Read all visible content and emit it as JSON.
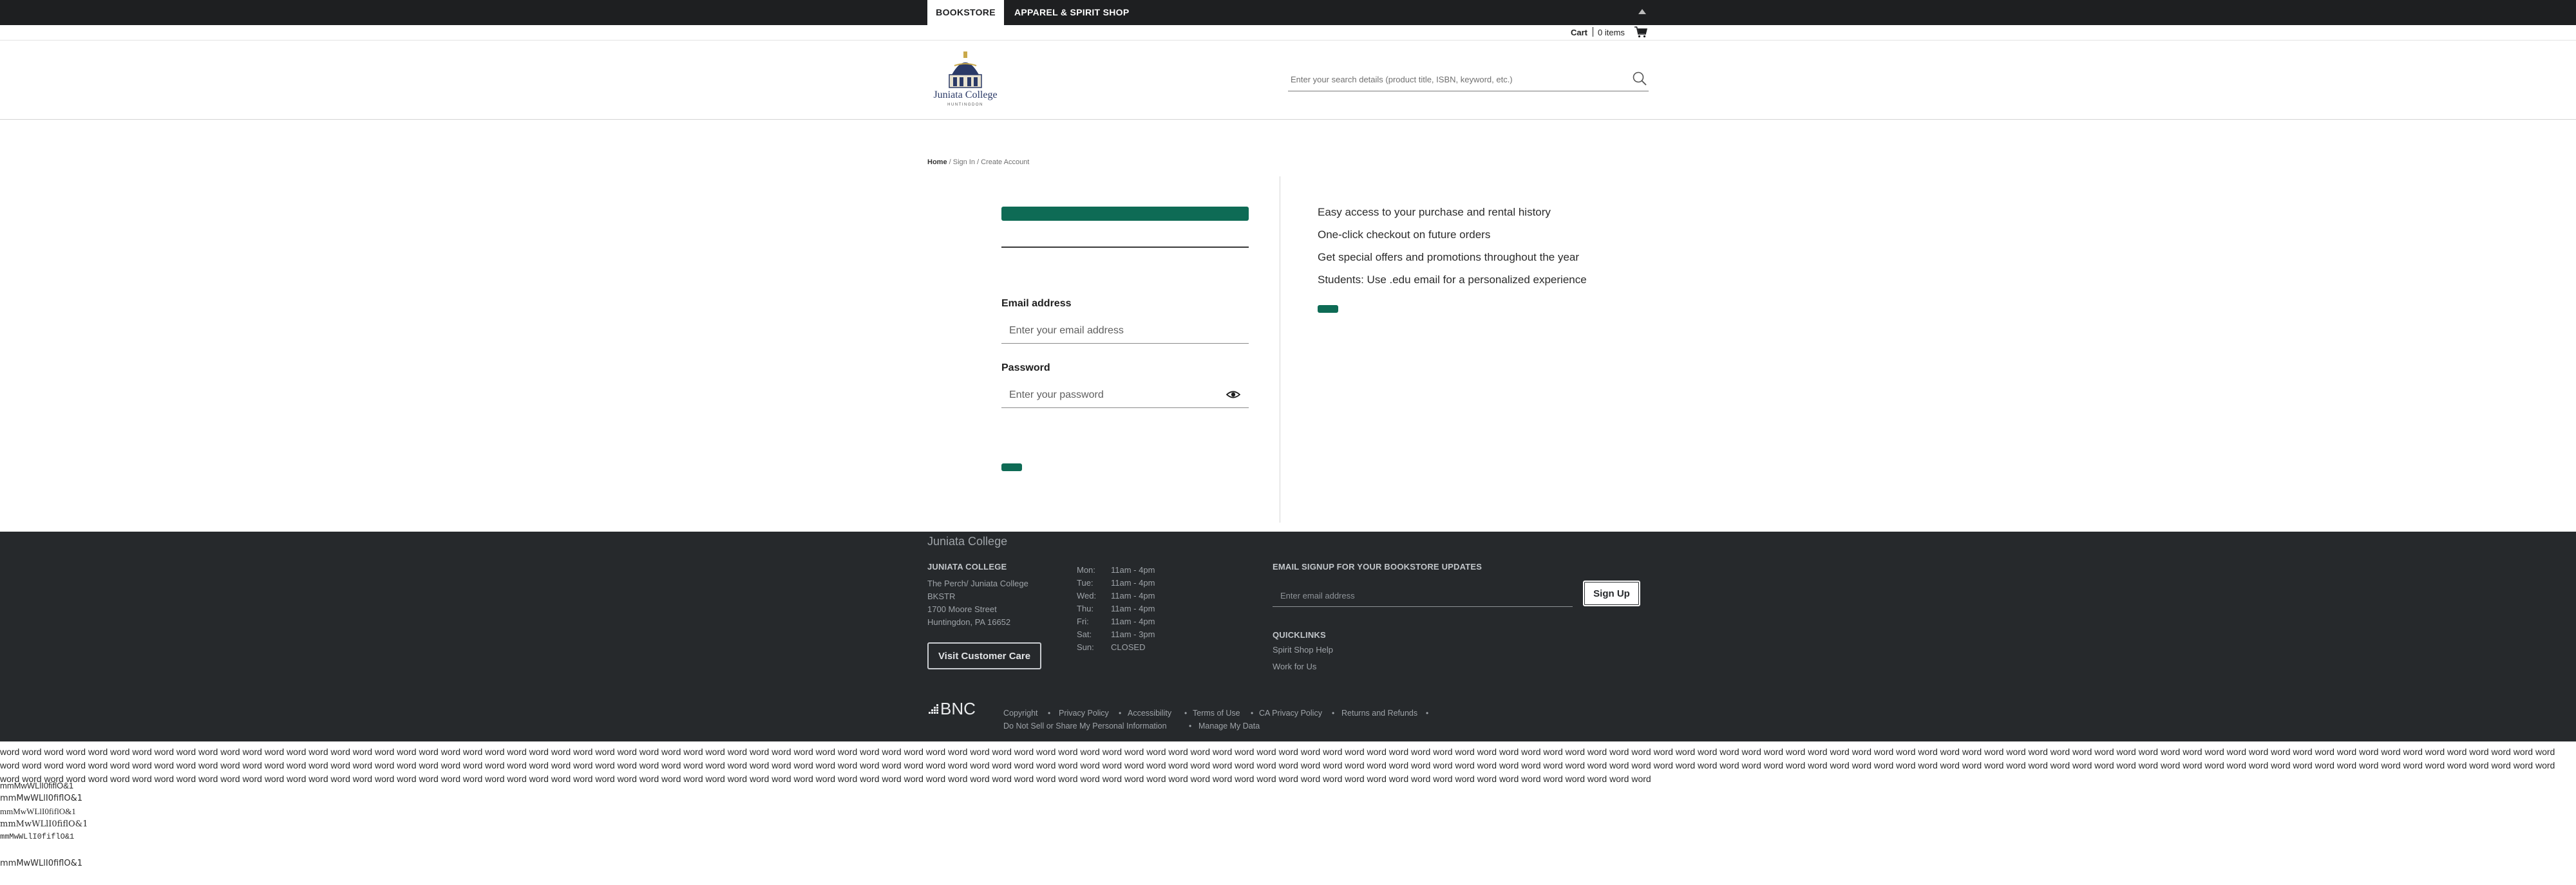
{
  "topbar": {
    "tab_bookstore": "BOOKSTORE",
    "tab_apparel": "APPAREL & SPIRIT SHOP"
  },
  "cart": {
    "label": "Cart",
    "items": "0 items"
  },
  "header": {
    "logo_name": "Juniata College",
    "logo_sub": "HUNTINGDON",
    "search_placeholder": "Enter your search details (product title, ISBN, keyword, etc.)"
  },
  "breadcrumb": {
    "home": "Home",
    "rest": " / Sign In / Create Account"
  },
  "signin": {
    "email_label": "Email address",
    "email_placeholder": "Enter your email address",
    "password_label": "Password",
    "password_placeholder": "Enter your password"
  },
  "benefits": [
    "Easy access to your purchase and rental history",
    "One-click checkout on future orders",
    "Get special offers and promotions throughout the year",
    "Students: Use .edu email for a personalized experience"
  ],
  "footer": {
    "store_name": "Juniata College",
    "address_heading": "JUNIATA COLLEGE",
    "address": [
      "The Perch/ Juniata College",
      "BKSTR",
      "1700 Moore Street",
      "Huntingdon, PA 16652"
    ],
    "visit_button": "Visit Customer Care",
    "hours": [
      {
        "day": "Mon:",
        "time": "11am - 4pm"
      },
      {
        "day": "Tue:",
        "time": "11am - 4pm"
      },
      {
        "day": "Wed:",
        "time": "11am - 4pm"
      },
      {
        "day": "Thu:",
        "time": "11am - 4pm"
      },
      {
        "day": "Fri:",
        "time": "11am - 4pm"
      },
      {
        "day": "Sat:",
        "time": "11am - 3pm"
      },
      {
        "day": "Sun:",
        "time": "CLOSED"
      }
    ],
    "signup_heading": "EMAIL SIGNUP FOR YOUR BOOKSTORE UPDATES",
    "signup_placeholder": "Enter email address",
    "signup_button": "Sign Up",
    "quicklinks_heading": "QUICKLINKS",
    "quicklinks": [
      "Spirit Shop Help",
      "Work for Us"
    ],
    "bnc_logo": "BNC",
    "legal_links": [
      "Copyright",
      "Privacy Policy",
      "Accessibility",
      "Terms of Use",
      "CA Privacy Policy",
      "Returns and Refunds",
      "Do Not Sell or Share My Personal Information",
      "Manage My Data"
    ]
  },
  "test_text": {
    "words": "word word word word word word word word word word word word word word word word word word word word word word word word word word word word word word word word word word word word word word word word word word word word word word word word word word word word word word word word word word word word word word word word word word word word word word word word word word word word word word word word word word word word word word word word word word word word word word word word word word word word word word word word word word word word word word word word word word word word word word word word word word word word word word word word word word word word word word word word word word word word word word word word word word word word word word word word word word word word word word word word word word word word word word word word word word word word word word word word word word word word word word word word word word word word word word word word word word word word word word word word word word word word word word word word word word word word word word word word word word word word word word word word word word word word word word word word word word word word word word word word word word word word word word word word word word word word word word word word word word word word word word word word word word word word word word word word word word word word word word word word word word word word word word word word word word word word word word word word word word word word word word word word word word word",
    "font_lines": [
      "mmMwWLlI0fiflO&1",
      "mmMwWLlI0fiflO&1",
      "mmMwWLlI0fiflO&1",
      "mmMwWLlI0fiflO&1",
      "mmMwWLlI0fiflO&1",
      "mmMwWLlI0fiflO&1"
    ]
  },
  "colors": {
    "accent_green": "#0e6b55",
    "topbar": "#1e1f21",
    "footer": "#26292c"
  }
}
